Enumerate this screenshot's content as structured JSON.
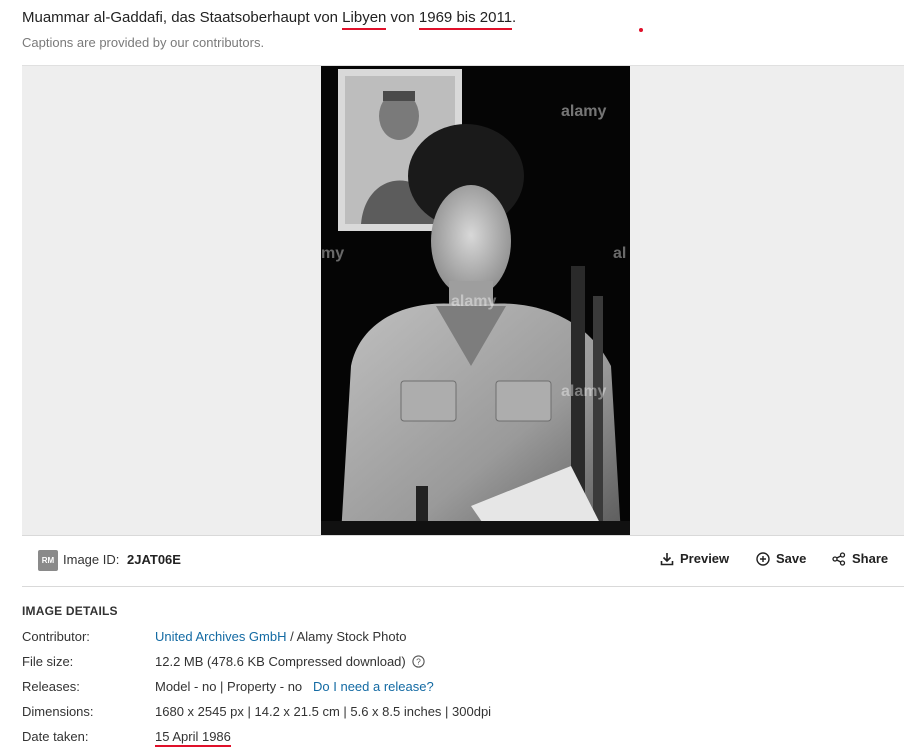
{
  "caption": {
    "part1": "Muammar al-Gaddafi, das Staatsoberhaupt von ",
    "libyen": "Libyen",
    "part2": " von ",
    "years": "1969 bis 2011",
    "part3": "."
  },
  "caption_note": "Captions are provided by our contributors.",
  "image": {
    "description_icon": "black-and-white-photo",
    "watermark": "alamy",
    "watermark_small": "a"
  },
  "toolbar": {
    "badge": "RM",
    "image_id_label": "Image ID:",
    "image_id_value": "2JAT06E",
    "preview_label": "Preview",
    "save_label": "Save",
    "share_label": "Share"
  },
  "details": {
    "title": "IMAGE DETAILS",
    "contributor_key": "Contributor:",
    "contributor_link": "United Archives GmbH",
    "contributor_rest": " / Alamy Stock Photo",
    "filesize_key": "File size:",
    "filesize_value": "12.2 MB (478.6 KB Compressed download)",
    "releases_key": "Releases:",
    "releases_value": "Model - no | Property - no",
    "releases_link": "Do I need a release?",
    "dimensions_key": "Dimensions:",
    "dimensions_value": "1680 x 2545 px | 14.2 x 21.5 cm | 5.6 x 8.5 inches | 300dpi",
    "date_key": "Date taken:",
    "date_value": "15 April 1986"
  },
  "colors": {
    "link": "#136aa3",
    "annotation_red": "#e0102a"
  }
}
